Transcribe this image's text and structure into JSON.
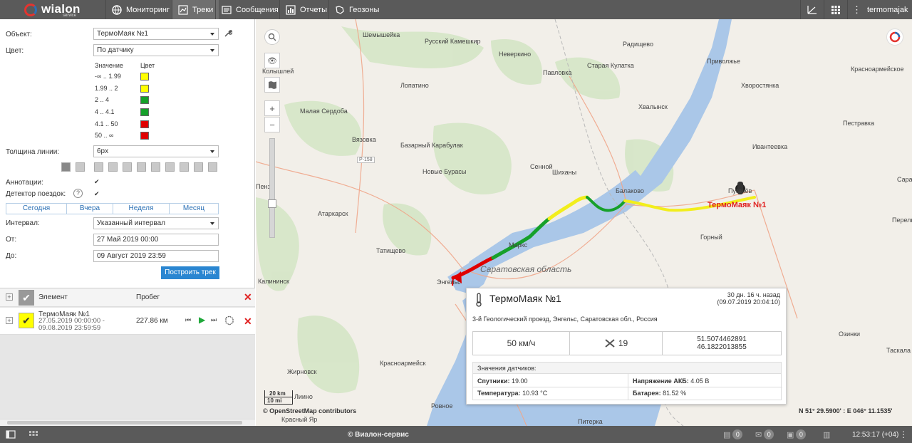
{
  "app": {
    "logo": "wialon",
    "logo_sub": "service"
  },
  "nav": {
    "tabs": [
      {
        "label": "Мониторинг",
        "icon": "globe-icon"
      },
      {
        "label": "Треки",
        "icon": "track-icon"
      },
      {
        "label": "Сообщения",
        "icon": "message-icon"
      },
      {
        "label": "Отчеты",
        "icon": "report-icon"
      },
      {
        "label": "Геозоны",
        "icon": "geofence-icon"
      }
    ],
    "user": "termomajak"
  },
  "panel": {
    "object_label": "Объект:",
    "object_value": "ТермоМаяк №1",
    "color_label": "Цвет:",
    "color_value": "По датчику",
    "legend_value_header": "Значение",
    "legend_color_header": "Цвет",
    "legend": [
      {
        "range": "-∞ .. 1.99",
        "color": "#ffff00"
      },
      {
        "range": "1.99 .. 2",
        "color": "#ffff00"
      },
      {
        "range": "2 .. 4",
        "color": "#16a02a"
      },
      {
        "range": "4 .. 4.1",
        "color": "#16a02a"
      },
      {
        "range": "4.1 .. 50",
        "color": "#e00000"
      },
      {
        "range": "50 .. ∞",
        "color": "#e00000"
      }
    ],
    "line_width_label": "Толщина линии:",
    "line_width_value": "6px",
    "annotations_label": "Аннотации:",
    "trip_detector_label": "Детектор поездок:",
    "periods": [
      "Сегодня",
      "Вчера",
      "Неделя",
      "Месяц"
    ],
    "interval_label": "Интервал:",
    "interval_value": "Указанный интервал",
    "from_label": "От:",
    "from_value": "27 Май 2019 00:00",
    "to_label": "До:",
    "to_value": "09 Август 2019 23:59",
    "build_button": "Построить трек",
    "grid": {
      "col_element": "Элемент",
      "col_mileage": "Пробег",
      "row_name": "ТермоМаяк №1",
      "row_period": "27.05.2019 00:00:00 - 09.08.2019 23:59:59",
      "row_mileage": "227.86 км"
    }
  },
  "map": {
    "towns": [
      "Шемышейка",
      "Русский Камешкир",
      "Неверкино",
      "Радищево",
      "Приволжье",
      "Красноармейское",
      "Старая Кулатка",
      "Павловка",
      "Хвалынск",
      "Хворостянка",
      "Лопатино",
      "Колышлей",
      "Малая Сердоба",
      "Пестравка",
      "Вязовка",
      "Ивантеевка",
      "Базарный Карабулак",
      "Сенной",
      "Новые Бурасы",
      "Шиханы",
      "Балаково",
      "Пугачёв",
      "Атаркарск",
      "Горный",
      "Татищево",
      "Маркс",
      "Саратовская область",
      "Калининск",
      "Энгельс",
      "Перелюб",
      "Озинки",
      "Таскала",
      "Жирновск",
      "Красноармейск",
      "Лиино",
      "Ровное",
      "Красный Яр",
      "Питерка",
      "Пенза",
      "Саратов"
    ],
    "route_label": "ТермоМаяк №1",
    "scale_km": "20 km",
    "scale_mi": "10 mi",
    "attribution": "© OpenStreetMap contributors",
    "coordinates": "N 51° 29.5900' : E 046° 11.1535'",
    "road_label": "Р-158"
  },
  "popup": {
    "title": "ТермоМаяк №1",
    "ago": "30 дн. 16 ч. назад",
    "time": "(09.07.2019 20:04:10)",
    "address": "3-й Геологический проезд, Энгельс, Саратовская обл., Россия",
    "speed": "50 км/ч",
    "satellites_count": "19",
    "lat": "51.5074462891",
    "lon": "46.1822013855",
    "sensors_header": "Значения датчиков:",
    "sensors": [
      {
        "name": "Спутники:",
        "value": "19.00"
      },
      {
        "name": "Напряжение АКБ:",
        "value": "4.05 В"
      },
      {
        "name": "Температура:",
        "value": "10.93 °C"
      },
      {
        "name": "Батарея:",
        "value": "81.52 %"
      }
    ]
  },
  "status": {
    "copyright": "© Виалон-сервис",
    "clock": "12:53:17 (+04)",
    "counters": [
      "0",
      "0",
      "0"
    ]
  }
}
